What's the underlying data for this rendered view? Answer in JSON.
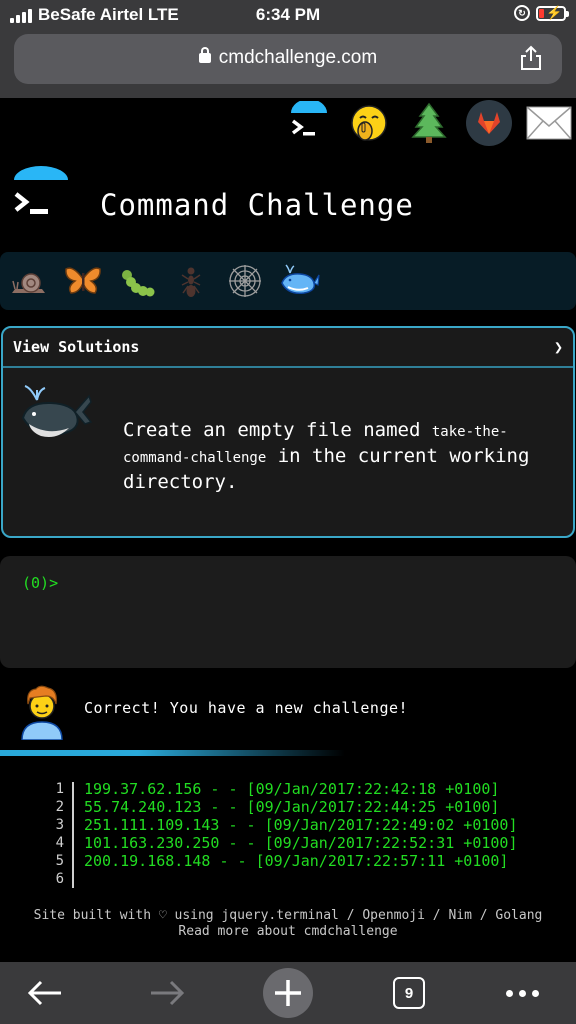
{
  "status_bar": {
    "carrier": "BeSafe Airtel  LTE",
    "time": "6:34 PM"
  },
  "browser": {
    "url": "cmdchallenge.com",
    "tab_count": "9"
  },
  "header": {
    "title": "Command Challenge",
    "icons": [
      "terminal-icon",
      "shushing-face-icon",
      "tree-icon",
      "gitlab-icon",
      "mail-icon"
    ]
  },
  "levels": [
    "snail-icon",
    "butterfly-icon",
    "caterpillar-icon",
    "ant-icon",
    "spider-web-icon",
    "whale-icon"
  ],
  "challenge": {
    "view_solutions_label": "View Solutions",
    "chevron": "❯",
    "text_before": "Create an empty file named ",
    "filename": "take-the-command-challenge",
    "text_after": " in the current working directory."
  },
  "terminal": {
    "prompt": "(0)>"
  },
  "result": {
    "message": "Correct! You have a new challenge!"
  },
  "code_lines": [
    {
      "num": "1",
      "text": "199.37.62.156 - - [09/Jan/2017:22:42:18 +0100]"
    },
    {
      "num": "2",
      "text": "55.74.240.123 - - [09/Jan/2017:22:44:25 +0100]"
    },
    {
      "num": "3",
      "text": "251.111.109.143 - - [09/Jan/2017:22:49:02 +0100]"
    },
    {
      "num": "4",
      "text": "101.163.230.250 - - [09/Jan/2017:22:52:31 +0100]"
    },
    {
      "num": "5",
      "text": "200.19.168.148 - - [09/Jan/2017:22:57:11 +0100]"
    },
    {
      "num": "6",
      "text": ""
    }
  ],
  "footer": {
    "line1": "Site built with ♡ using jquery.terminal / Openmoji / Nim / Golang",
    "line2": "Read more about cmdchallenge"
  },
  "colors": {
    "accent_blue": "#3aa7c8",
    "terminal_green": "#22dd22",
    "gitlab_orange": "#e2432a"
  }
}
